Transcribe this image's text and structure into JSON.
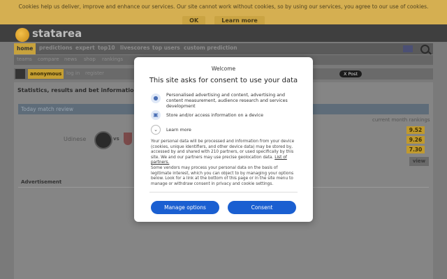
{
  "cookie_bar": {
    "message": "Cookies help us deliver, improve and enhance our services. Our site cannot work without cookies, so by using our services, you agree to our use of cookies.",
    "ok_label": "OK",
    "learn_more_label": "Learn more"
  },
  "site": {
    "logo_text": "statarea"
  },
  "nav": {
    "items": [
      "home",
      "predictions",
      "expert",
      "top10",
      "livescores",
      "top users",
      "custom prediction"
    ]
  },
  "subnav": {
    "items": [
      "teams",
      "compare",
      "news",
      "shop",
      "rankings"
    ]
  },
  "userbar": {
    "username": "anonymous",
    "login": "log in",
    "register": "register",
    "x_post": "X Post"
  },
  "main": {
    "headline": "Statistics, results and bet information.",
    "today_label": "Today match review",
    "current_month": "current month rankings",
    "home_team": "Udinese",
    "vs": "vs",
    "rankings": [
      "9.52",
      "9.26",
      "7.30"
    ],
    "view_label": "view",
    "advertisement": "Advertisement"
  },
  "consent": {
    "welcome": "Welcome",
    "title": "This site asks for consent to use your data",
    "purposes": [
      "Personalised advertising and content, advertising and content measurement, audience research and services development",
      "Store and/or access information on a device"
    ],
    "learn_more": "Learn more",
    "para1": "Your personal data will be processed and information from your device (cookies, unique identifiers, and other device data) may be stored by, accessed by and shared with 210 partners, or used specifically by this site. We and our partners may use precise geolocation data.",
    "partners_link": "List of partners.",
    "para2": "Some vendors may process your personal data on the basis of legitimate interest, which you can object to by managing your options below. Look for a link at the bottom of this page or in the site menu to manage or withdraw consent in privacy and cookie settings.",
    "manage_label": "Manage options",
    "consent_label": "Consent"
  },
  "colors": {
    "accent": "#c7a23d",
    "consent_button": "#1a5fd1"
  }
}
